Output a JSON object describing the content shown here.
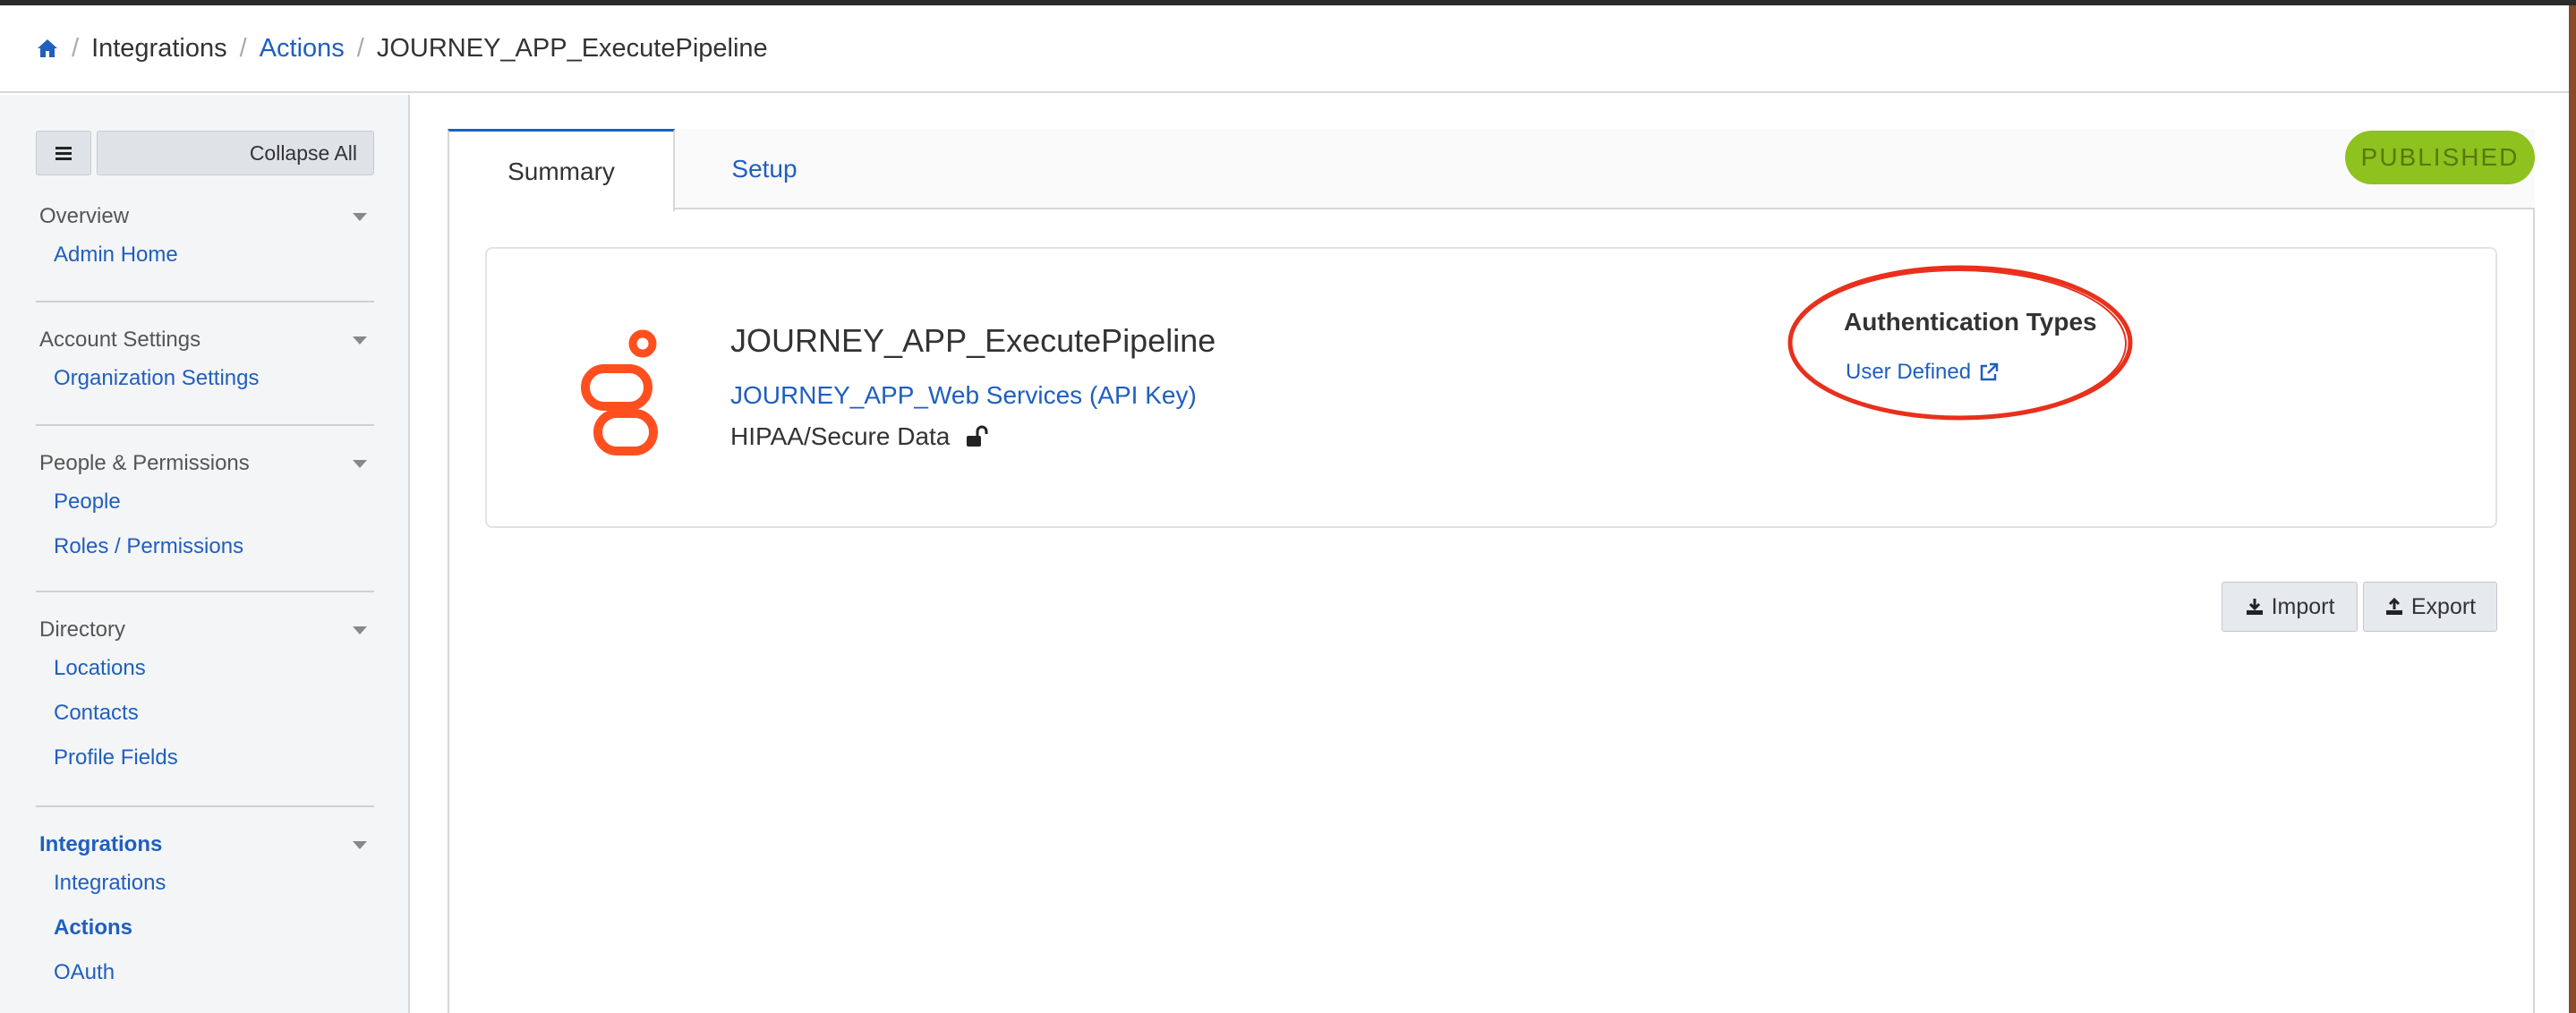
{
  "breadcrumb": {
    "home_icon": "home-icon",
    "items": [
      {
        "label": "Integrations",
        "link": false
      },
      {
        "label": "Actions",
        "link": true
      },
      {
        "label": "JOURNEY_APP_ExecutePipeline",
        "link": false
      }
    ],
    "separator": "/"
  },
  "sidebar": {
    "menu_icon": "hamburger-icon",
    "collapse_label": "Collapse All",
    "sections": [
      {
        "title": "Overview",
        "items": [
          "Admin Home"
        ]
      },
      {
        "title": "Account Settings",
        "items": [
          "Organization Settings"
        ]
      },
      {
        "title": "People & Permissions",
        "items": [
          "People",
          "Roles / Permissions"
        ]
      },
      {
        "title": "Directory",
        "items": [
          "Locations",
          "Contacts",
          "Profile Fields"
        ]
      },
      {
        "title": "Integrations",
        "items": [
          "Integrations",
          "Actions",
          "OAuth"
        ]
      }
    ]
  },
  "tabs": [
    {
      "label": "Summary",
      "active": true
    },
    {
      "label": "Setup",
      "active": false
    }
  ],
  "status": {
    "label": "PUBLISHED",
    "color": "#8ec21f"
  },
  "action": {
    "logo_icon": "genesys-logo-icon",
    "name": "JOURNEY_APP_ExecutePipeline",
    "integration_link": "JOURNEY_APP_Web Services (API Key)",
    "secure_label": "HIPAA/Secure Data",
    "secure_icon": "unlocked-icon"
  },
  "auth": {
    "title": "Authentication Types",
    "link_label": "User Defined",
    "link_icon": "external-link-icon"
  },
  "buttons": {
    "import_label": "Import",
    "import_icon": "download-icon",
    "export_label": "Export",
    "export_icon": "upload-icon"
  },
  "colors": {
    "accent": "#1f5fbf",
    "logo": "#ff4f1f",
    "annotation": "#e8301c"
  }
}
